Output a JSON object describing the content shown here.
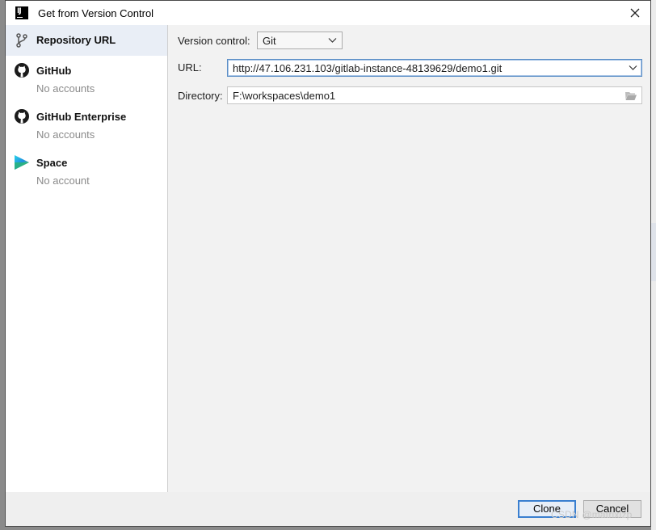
{
  "window": {
    "title": "Get from Version Control",
    "app_icon_text": "IJ"
  },
  "sidebar": {
    "items": [
      {
        "label": "Repository URL",
        "sub": "",
        "icon": "branch-icon",
        "selected": true
      },
      {
        "label": "GitHub",
        "sub": "No accounts",
        "icon": "github-icon",
        "selected": false
      },
      {
        "label": "GitHub Enterprise",
        "sub": "No accounts",
        "icon": "github-icon",
        "selected": false
      },
      {
        "label": "Space",
        "sub": "No account",
        "icon": "space-icon",
        "selected": false
      }
    ]
  },
  "form": {
    "version_control_label": "Version control:",
    "version_control_value": "Git",
    "url_label": "URL:",
    "url_value": "http://47.106.231.103/gitlab-instance-48139629/demo1.git",
    "directory_label": "Directory:",
    "directory_value": "F:\\workspaces\\demo1"
  },
  "buttons": {
    "clone": "Clone",
    "cancel": "Cancel"
  },
  "watermark": "CSDN @matrixlzp",
  "colors": {
    "selection": "#e9eef6",
    "focus_border": "#5b8ec6",
    "default_button_border": "#3a7fd0"
  }
}
